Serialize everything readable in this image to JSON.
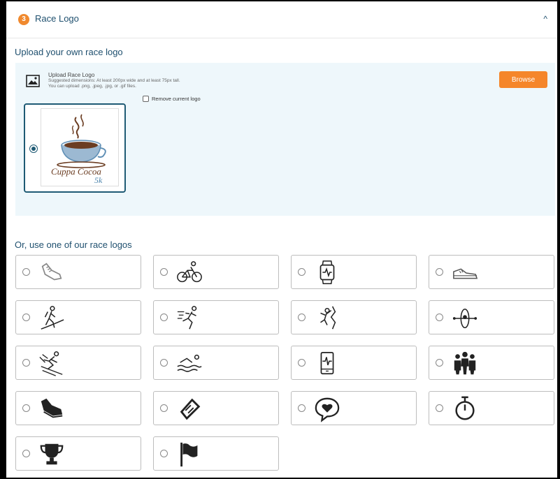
{
  "header": {
    "step": "3",
    "title": "Race Logo",
    "caret": "^"
  },
  "upload_section": {
    "title": "Upload your own race logo",
    "label": "Upload Race Logo",
    "hint_line1": "Suggested dimensions: At least 200px wide and at least 75px tall.",
    "hint_line2": "You can upload .png, .jpeg, .jpg, or .gif files.",
    "browse": "Browse",
    "remove_label": "Remove current logo",
    "current_logo": {
      "line1": "Cuppa Cocoa",
      "line2": "5k"
    }
  },
  "stock_section": {
    "title": "Or, use one of our race logos",
    "logos": [
      {
        "icon": "running-shoe-outline-icon"
      },
      {
        "icon": "cyclist-icon"
      },
      {
        "icon": "fitness-watch-icon"
      },
      {
        "icon": "sneaker-outline-icon"
      },
      {
        "icon": "hiker-icon"
      },
      {
        "icon": "runner-icon"
      },
      {
        "icon": "climber-icon"
      },
      {
        "icon": "kayak-icon"
      },
      {
        "icon": "skier-icon"
      },
      {
        "icon": "swimmer-icon"
      },
      {
        "icon": "phone-heartbeat-icon"
      },
      {
        "icon": "group-icon"
      },
      {
        "icon": "running-shoe-icon"
      },
      {
        "icon": "ticket-icon"
      },
      {
        "icon": "heart-chat-icon"
      },
      {
        "icon": "stopwatch-icon"
      },
      {
        "icon": "trophy-icon"
      },
      {
        "icon": "flag-icon"
      }
    ]
  },
  "colors": {
    "accent": "#f0892e",
    "heading": "#1e4f6e",
    "upload_bg": "#eef7fb",
    "selected_border": "#1e5a74"
  }
}
